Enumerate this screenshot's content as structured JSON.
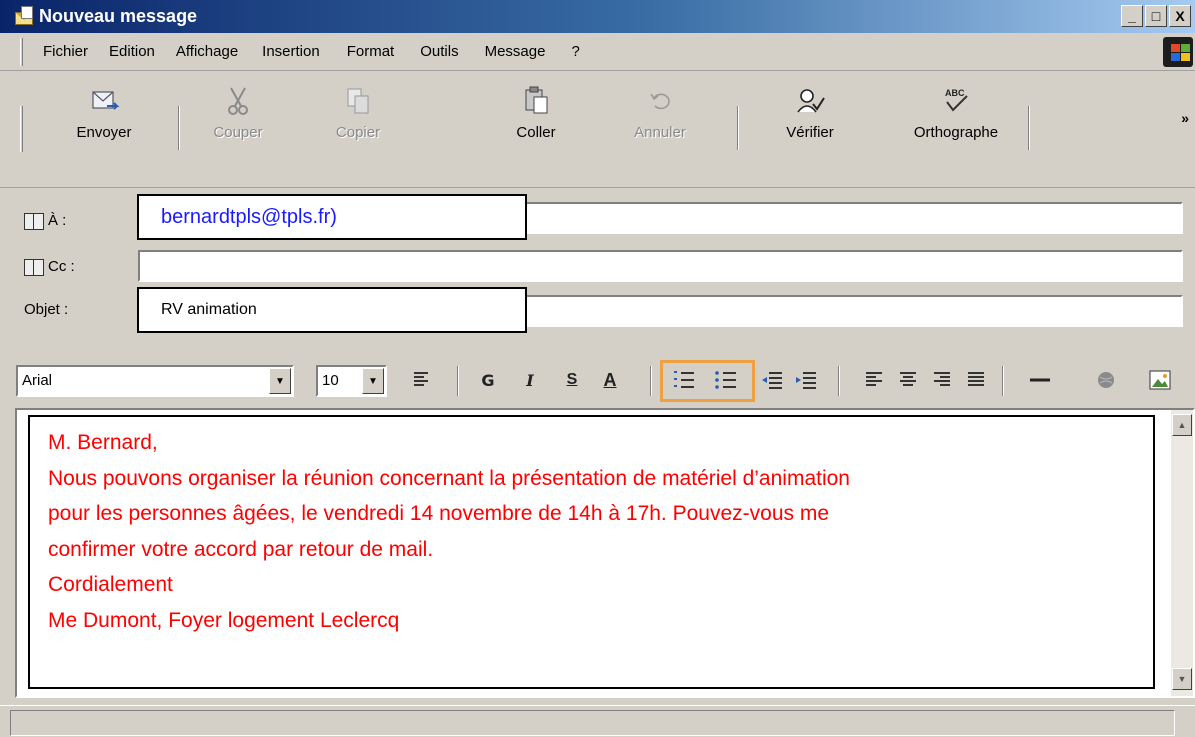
{
  "window": {
    "title": "Nouveau message",
    "controls": [
      "_",
      "□",
      "X"
    ]
  },
  "menu": {
    "items": [
      "Fichier",
      "Edition",
      "Affichage",
      "Insertion",
      "Format",
      "Outils",
      "Message",
      "?"
    ]
  },
  "toolbar": {
    "buttons": [
      {
        "label": "Envoyer",
        "icon": "send-icon",
        "enabled": true
      },
      {
        "label": "Couper",
        "icon": "scissors-icon",
        "enabled": false
      },
      {
        "label": "Copier",
        "icon": "copy-icon",
        "enabled": false
      },
      {
        "label": "Coller",
        "icon": "paste-icon",
        "enabled": true
      },
      {
        "label": "Annuler",
        "icon": "undo-icon",
        "enabled": false
      },
      {
        "label": "Vérifier",
        "icon": "check-names-icon",
        "enabled": true
      },
      {
        "label": "Orthographe",
        "icon": "spelling-icon",
        "enabled": true
      }
    ],
    "more": "»"
  },
  "header": {
    "to_label": "À :",
    "to_value": "bernardtpls@tpls.fr)",
    "cc_label": "Cc :",
    "cc_value": "",
    "subject_label": "Objet :",
    "subject_value": "RV animation"
  },
  "format": {
    "font": "Arial",
    "size": "10",
    "bold": "G",
    "italic": "I",
    "underline": "S",
    "color": "A"
  },
  "message": {
    "lines": [
      "M. Bernard,",
      "Nous pouvons organiser la réunion concernant la présentation de matériel d’animation",
      "pour les personnes âgées, le vendredi 14 novembre de 14h à 17h. Pouvez-vous me",
      "confirmer votre accord par retour de mail.",
      "Cordialement",
      "Me Dumont, Foyer logement Leclercq"
    ],
    "text_color": "#ff0000"
  },
  "colors": {
    "title_start": "#0a246a",
    "title_end": "#a6caf0",
    "highlight": "#f0a040",
    "link": "#1a1aff"
  }
}
